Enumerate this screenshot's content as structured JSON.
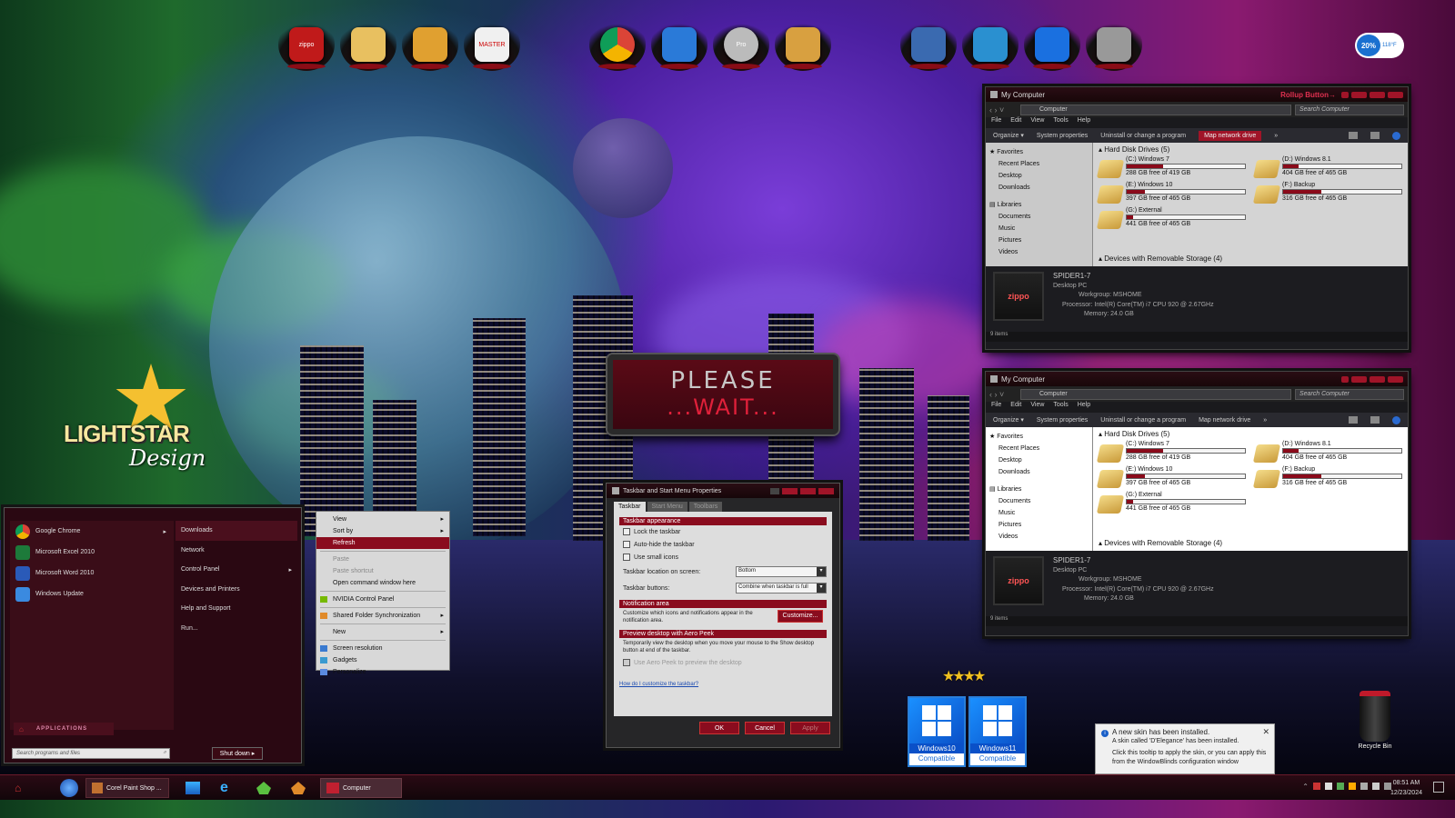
{
  "brand": {
    "logo_line1": "LIGHTSTAR",
    "logo_line2": "Design"
  },
  "colors": {
    "accent": "#8a0c1e",
    "titlebar": "#1a070b"
  },
  "dock": {
    "left": [
      {
        "icon": "zippo-icon",
        "label": "zippo"
      },
      {
        "icon": "folder-icon",
        "label": ""
      },
      {
        "icon": "winamp-icon",
        "label": ""
      },
      {
        "icon": "tasks-icon",
        "label": "MASTER"
      }
    ],
    "center": [
      {
        "icon": "chrome-icon",
        "label": ""
      },
      {
        "icon": "email-icon",
        "label": ""
      },
      {
        "icon": "pro-icon",
        "label": "Pro"
      },
      {
        "icon": "addressbook-icon",
        "label": ""
      }
    ],
    "right": [
      {
        "icon": "box-icon",
        "label": ""
      },
      {
        "icon": "x-window-icon",
        "label": ""
      },
      {
        "icon": "blue-window-icon",
        "label": ""
      },
      {
        "icon": "server-icon",
        "label": ""
      }
    ]
  },
  "weather": {
    "percent": "20%",
    "temp": "118°F"
  },
  "please_wait": {
    "line1": "PLEASE",
    "line2": "...WAIT..."
  },
  "explorer": {
    "title": "My Computer",
    "rollup_label": "Rollup Button→",
    "path": "Computer",
    "search_placeholder": "Search Computer",
    "menu": [
      "File",
      "Edit",
      "View",
      "Tools",
      "Help"
    ],
    "commands": {
      "organize": "Organize",
      "system": "System properties",
      "uninstall": "Uninstall or change a program",
      "map": "Map network drive",
      "more": "»"
    },
    "nav": {
      "favorites": "Favorites",
      "recent": "Recent Places",
      "desktop": "Desktop",
      "downloads": "Downloads",
      "libraries": "Libraries",
      "documents": "Documents",
      "music": "Music",
      "pictures": "Pictures",
      "videos": "Videos"
    },
    "hdd_header": "Hard Disk Drives (5)",
    "removable_header": "Devices with Removable Storage (4)",
    "drives": [
      {
        "name": "(C:) Windows 7",
        "free": "288 GB free of 419 GB",
        "used": 0.31
      },
      {
        "name": "(D:) Windows 8.1",
        "free": "404 GB free of 465 GB",
        "used": 0.13
      },
      {
        "name": "(E:) Windows 10",
        "free": "397 GB free of 465 GB",
        "used": 0.15
      },
      {
        "name": "(F:) Backup",
        "free": "316 GB free of 465 GB",
        "used": 0.32
      },
      {
        "name": "(G:) External",
        "free": "441 GB free of 465 GB",
        "used": 0.05
      }
    ],
    "computer": {
      "name": "SPIDER1-7",
      "type": "Desktop PC",
      "workgroup": "Workgroup: MSHOME",
      "processor": "Processor: Intel(R) Core(TM) i7 CPU       920  @ 2.67GHz",
      "memory": "Memory: 24.0 GB",
      "pc_label": "zippo"
    },
    "status": "9 items"
  },
  "startmenu": {
    "programs": [
      {
        "label": "Google Chrome",
        "icon": "chrome-icon"
      },
      {
        "label": "Microsoft Excel 2010",
        "icon": "excel-icon"
      },
      {
        "label": "Microsoft Word 2010",
        "icon": "word-icon"
      },
      {
        "label": "Windows Update",
        "icon": "update-icon"
      }
    ],
    "places": [
      "Downloads",
      "Network",
      "Control Panel",
      "Devices and Printers",
      "Help and Support",
      "Run..."
    ],
    "all_apps": "APPLICATIONS",
    "search_placeholder": "Search programs and files",
    "shutdown": "Shut down"
  },
  "context_menu": {
    "view": "View",
    "sort": "Sort by",
    "refresh": "Refresh",
    "paste": "Paste",
    "paste_shortcut": "Paste shortcut",
    "cmd": "Open command window here",
    "nvidia": "NVIDIA Control Panel",
    "shared": "Shared Folder Synchronization",
    "new": "New",
    "screen": "Screen resolution",
    "gadgets": "Gadgets",
    "personalize": "Personalize"
  },
  "dialog": {
    "title": "Taskbar and Start Menu Properties",
    "tabs": [
      "Taskbar",
      "Start Menu",
      "Toolbars"
    ],
    "appearance": "Taskbar appearance",
    "lock": "Lock the taskbar",
    "autohide": "Auto-hide the taskbar",
    "small": "Use small icons",
    "location_label": "Taskbar location on screen:",
    "location_value": "Bottom",
    "buttons_label": "Taskbar buttons:",
    "buttons_value": "Combine when taskbar is full",
    "notif_header": "Notification area",
    "notif_text": "Customize which icons and notifications appear in the notification area.",
    "customize": "Customize...",
    "peek_header": "Preview desktop with Aero Peek",
    "peek_text": "Temporarily view the desktop when you move your mouse to the Show desktop button at end of the taskbar.",
    "peek_check": "Use Aero Peek to preview the desktop",
    "help_link": "How do I customize the taskbar?",
    "ok": "OK",
    "cancel": "Cancel",
    "apply": "Apply"
  },
  "badges": [
    {
      "line1": "Windows10",
      "line2": "Compatible"
    },
    {
      "line1": "Windows11",
      "line2": "Compatible"
    }
  ],
  "recycle": "Recycle Bin",
  "notification": {
    "title": "A new skin has been installed.",
    "line1": "A skin called 'D'Elegance' has been installed.",
    "line2": "Click this tooltip to apply the skin, or you can apply this from the WindowBlinds configuration window"
  },
  "taskbar": {
    "paintshop": "Corel Paint Shop ...",
    "computer": "Computer",
    "time": "08:51 AM",
    "date": "12/23/2024"
  }
}
